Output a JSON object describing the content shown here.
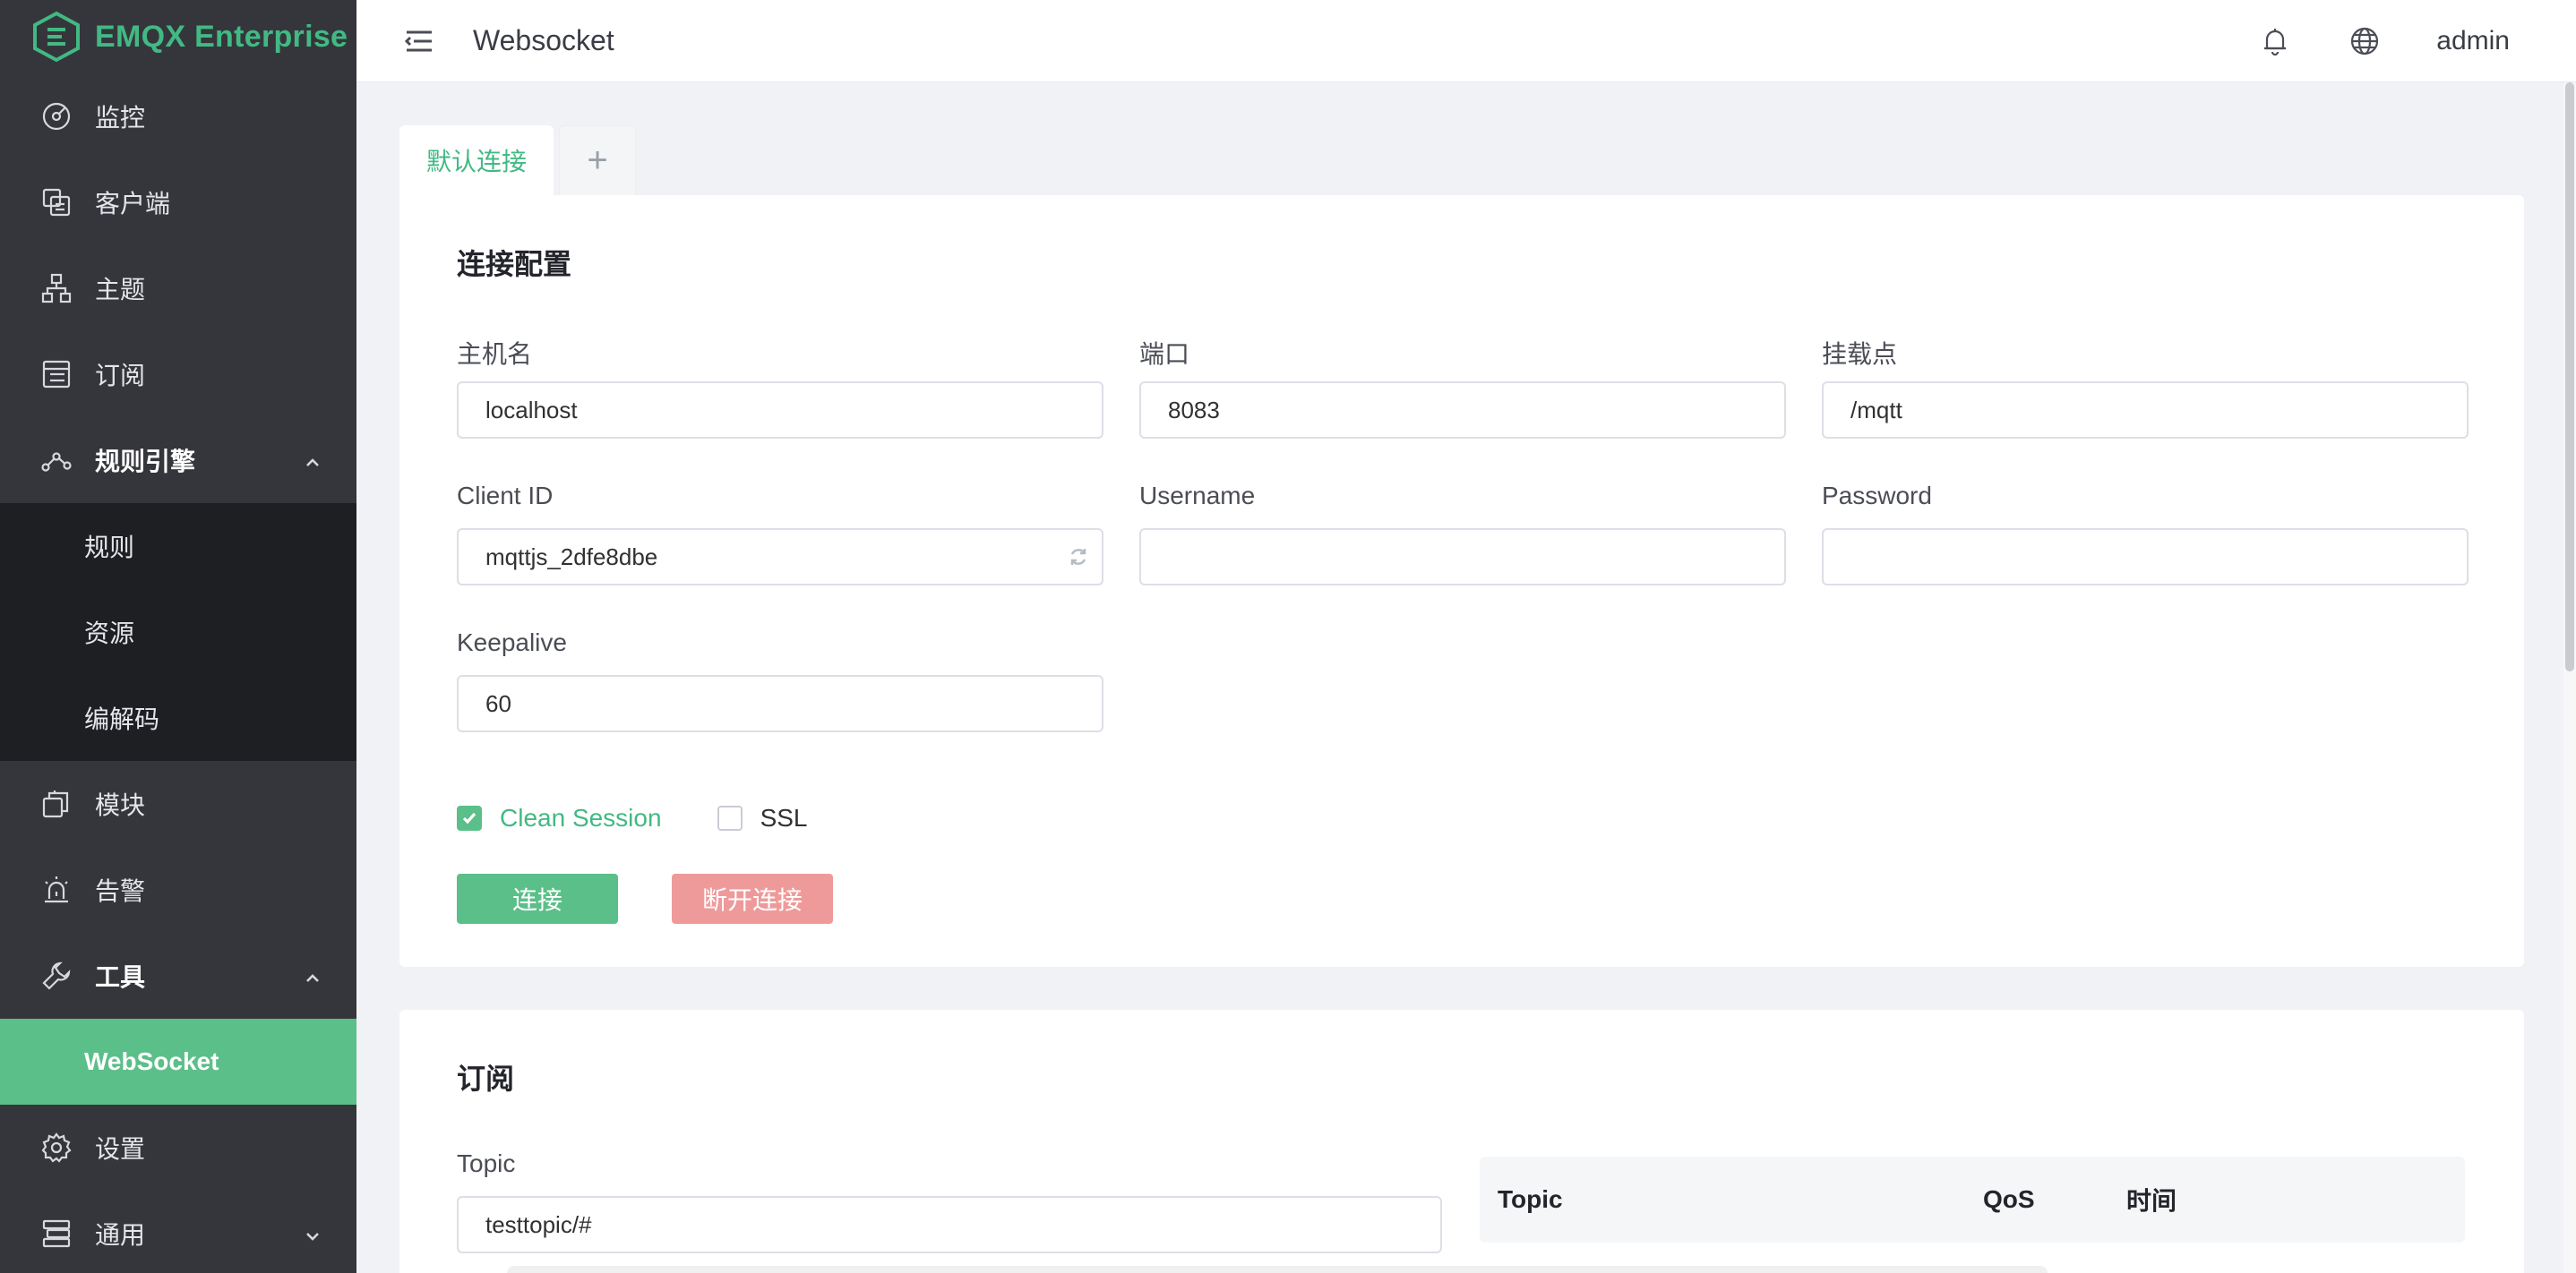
{
  "brand": {
    "name": "EMQX Enterprise",
    "color": "#42b983"
  },
  "sidebar": {
    "items": [
      {
        "label": "监控",
        "icon": "dashboard-icon"
      },
      {
        "label": "客户端",
        "icon": "clients-icon"
      },
      {
        "label": "主题",
        "icon": "topics-icon"
      },
      {
        "label": "订阅",
        "icon": "subscriptions-icon"
      },
      {
        "label": "规则引擎",
        "icon": "rule-engine-icon",
        "expanded": true,
        "children": [
          "规则",
          "资源",
          "编解码"
        ]
      },
      {
        "label": "模块",
        "icon": "modules-icon"
      },
      {
        "label": "告警",
        "icon": "alarm-icon"
      },
      {
        "label": "工具",
        "icon": "tools-icon",
        "expanded": true,
        "children": [
          "WebSocket"
        ],
        "active_child": "WebSocket"
      },
      {
        "label": "设置",
        "icon": "settings-icon"
      },
      {
        "label": "通用",
        "icon": "general-icon",
        "expanded": false
      }
    ]
  },
  "header": {
    "title": "Websocket",
    "user": "admin"
  },
  "tabs": [
    {
      "label": "默认连接",
      "active": true
    },
    {
      "label": "+"
    }
  ],
  "connection": {
    "title": "连接配置",
    "host_label": "主机名",
    "host_value": "localhost",
    "port_label": "端口",
    "port_value": "8083",
    "mount_label": "挂载点",
    "mount_value": "/mqtt",
    "clientid_label": "Client ID",
    "clientid_value": "mqttjs_2dfe8dbe",
    "username_label": "Username",
    "username_value": "",
    "password_label": "Password",
    "password_value": "",
    "keepalive_label": "Keepalive",
    "keepalive_value": "60",
    "clean_session_label": "Clean Session",
    "clean_session_checked": true,
    "ssl_label": "SSL",
    "ssl_checked": false,
    "connect_label": "连接",
    "disconnect_label": "断开连接"
  },
  "subscribe": {
    "title": "订阅",
    "topic_label": "Topic",
    "topic_value": "testtopic/#",
    "table_headers": [
      "Topic",
      "QoS",
      "时间"
    ]
  },
  "colors": {
    "accent": "#5bbf89",
    "danger_light": "#ef9a9a",
    "sidebar_bg": "#35363c",
    "submenu_bg": "#1e1f23"
  }
}
